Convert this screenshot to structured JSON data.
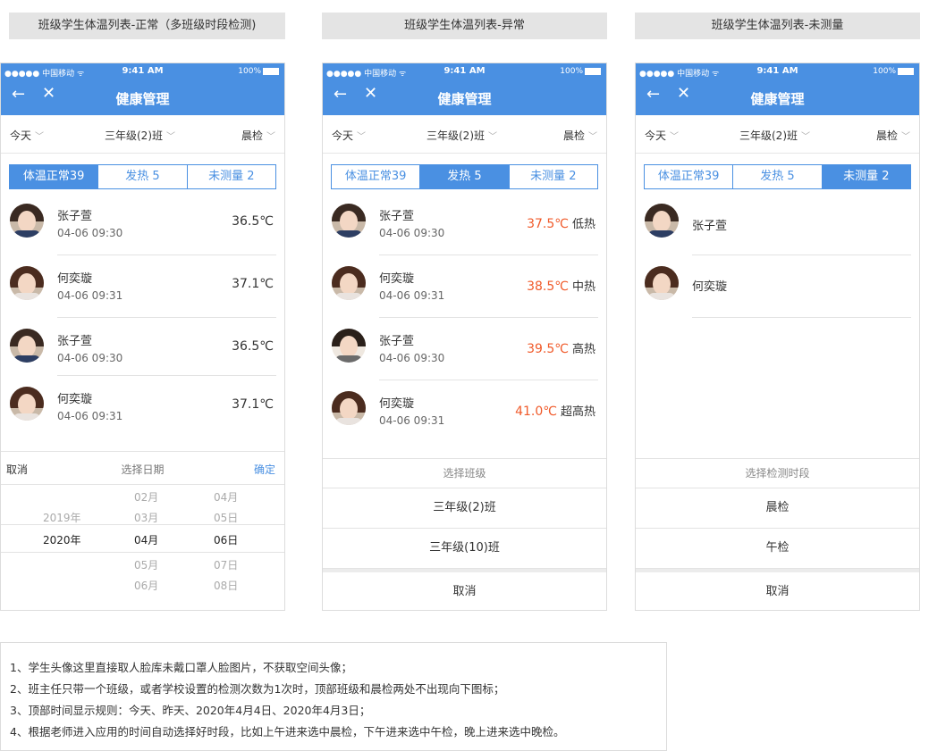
{
  "headers": [
    "班级学生体温列表-正常（多班级时段检测)",
    "班级学生体温列表-异常",
    "班级学生体温列表-未测量"
  ],
  "status_bar": {
    "carrier": "●●●●● 中国移动 ᯤ",
    "time": "9:41 AM",
    "battery": "100%"
  },
  "nav": {
    "back": "←",
    "close": "✕",
    "title": "健康管理"
  },
  "filters": {
    "day": "今天",
    "class": "三年级(2)班",
    "period": "晨检"
  },
  "tabs": {
    "normal": "体温正常39",
    "fever": "发热 5",
    "unmeasured": "未测量 2"
  },
  "screen1": {
    "rows": [
      {
        "name": "张子萱",
        "time": "04-06 09:30",
        "temp": "36.5℃"
      },
      {
        "name": "何奕璇",
        "time": "04-06 09:31",
        "temp": "37.1℃"
      },
      {
        "name": "张子萱",
        "time": "04-06 09:30",
        "temp": "36.5℃"
      },
      {
        "name": "何奕璇",
        "time": "04-06 09:31",
        "temp": "37.1℃"
      }
    ],
    "picker": {
      "cancel": "取消",
      "title": "选择日期",
      "ok": "确定",
      "years": [
        "2019年",
        "2020年"
      ],
      "months": [
        "02月",
        "03月",
        "04月",
        "05月",
        "06月"
      ],
      "days": [
        "04月",
        "05日",
        "06日",
        "07日",
        "08日"
      ]
    }
  },
  "screen2": {
    "rows": [
      {
        "name": "张子萱",
        "time": "04-06 09:30",
        "temp": "37.5℃",
        "level": "低热"
      },
      {
        "name": "何奕璇",
        "time": "04-06 09:31",
        "temp": "38.5℃",
        "level": "中热"
      },
      {
        "name": "张子萱",
        "time": "04-06 09:30",
        "temp": "39.5℃",
        "level": "高热"
      },
      {
        "name": "何奕璇",
        "time": "04-06 09:31",
        "temp": "41.0℃",
        "level": "超高热"
      }
    ],
    "sheet": {
      "title": "选择班级",
      "options": [
        "三年级(2)班",
        "三年级(10)班"
      ],
      "cancel": "取消"
    }
  },
  "screen3": {
    "rows": [
      {
        "name": "张子萱"
      },
      {
        "name": "何奕璇"
      }
    ],
    "sheet": {
      "title": "选择检测时段",
      "options": [
        "晨检",
        "午检"
      ],
      "cancel": "取消"
    }
  },
  "notes": [
    "1、学生头像这里直接取人脸库未戴口罩人脸图片，不获取空间头像；",
    "2、班主任只带一个班级，或者学校设置的检测次数为1次时，顶部班级和晨检两处不出现向下图标；",
    "3、顶部时间显示规则：今天、昨天、2020年4月4日、2020年4月3日；",
    "4、根据老师进入应用的时间自动选择好时段，比如上午进来选中晨检，下午进来选中午检，晚上进来选中晚检。"
  ],
  "colors": {
    "primary": "#4a90e2",
    "danger": "#f05a2a"
  }
}
